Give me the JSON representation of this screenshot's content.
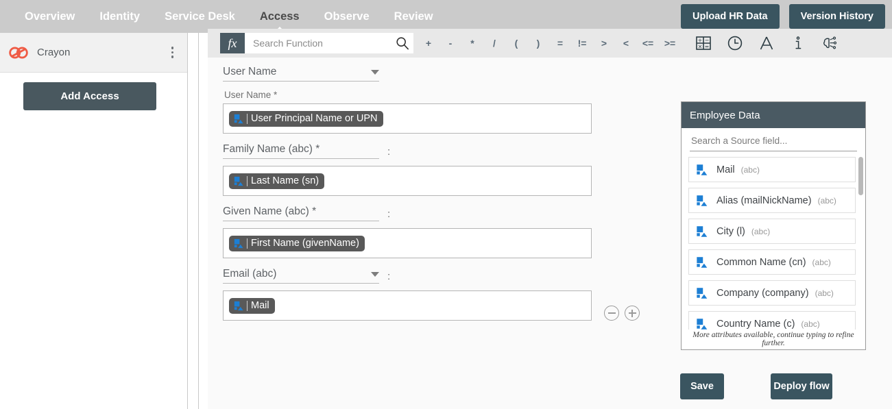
{
  "nav": {
    "items": [
      {
        "label": "Overview",
        "active": false
      },
      {
        "label": "Identity",
        "active": false
      },
      {
        "label": "Service Desk",
        "active": false
      },
      {
        "label": "Access",
        "active": true
      },
      {
        "label": "Observe",
        "active": false
      },
      {
        "label": "Review",
        "active": false
      }
    ],
    "upload_button": "Upload HR Data",
    "version_button": "Version History"
  },
  "sidebar": {
    "org_name": "Crayon",
    "add_access_button": "Add Access"
  },
  "toolbar": {
    "fx_label": "fx",
    "search_placeholder": "Search Function",
    "operators": [
      "+",
      "-",
      "*",
      "/",
      "(",
      ")",
      "=",
      "!=",
      ">",
      "<",
      "<=",
      ">="
    ],
    "icons": [
      "calculator-icon",
      "clock-icon",
      "text-icon",
      "info-icon",
      "ai-brain-icon"
    ]
  },
  "form": {
    "selector": {
      "value": "User Name"
    },
    "fields": [
      {
        "label": "User Name *",
        "chip": "User Principal Name or UPN",
        "has_selector": false,
        "selector_value": "",
        "colon": ""
      },
      {
        "label": "",
        "chip": "Last Name (sn)",
        "has_selector": true,
        "selector_value": "Family Name (abc) *",
        "selector_caret": false,
        "colon": ":"
      },
      {
        "label": "",
        "chip": "First Name (givenName)",
        "has_selector": true,
        "selector_value": "Given Name (abc) *",
        "selector_caret": false,
        "colon": ":"
      },
      {
        "label": "",
        "chip": "Mail",
        "has_selector": true,
        "selector_value": "Email (abc)",
        "selector_caret": true,
        "colon": ":"
      }
    ]
  },
  "employee_panel": {
    "title": "Employee Data",
    "search_placeholder": "Search a Source field...",
    "items": [
      {
        "name": "Mail",
        "type": "(abc)"
      },
      {
        "name": "Alias (mailNickName)",
        "type": "(abc)"
      },
      {
        "name": "City (l)",
        "type": "(abc)"
      },
      {
        "name": "Common Name (cn)",
        "type": "(abc)"
      },
      {
        "name": "Company (company)",
        "type": "(abc)"
      },
      {
        "name": "Country Name (c)",
        "type": "(abc)"
      }
    ],
    "footer_note": "More attributes available, continue typing to refine further."
  },
  "actions": {
    "save": "Save",
    "deploy": "Deploy flow"
  },
  "colors": {
    "nav_bg": "#cbcbcb",
    "accent_dark": "#3a5560",
    "panel_header": "#4a5a63",
    "chip_bg": "#595959",
    "chip_icon_blue": "#1d7fd4",
    "logo_orange": "#ef5b45"
  }
}
